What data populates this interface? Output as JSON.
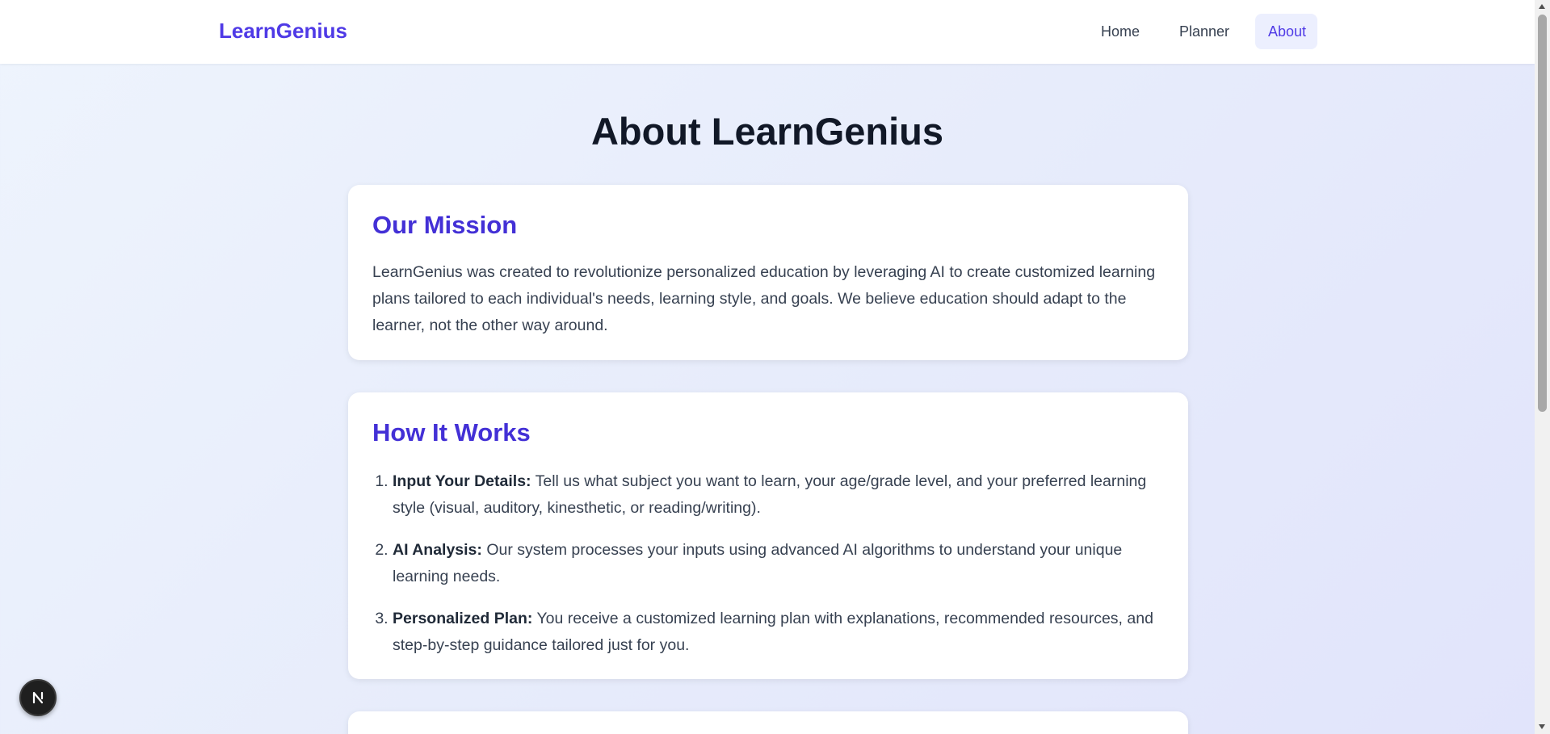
{
  "nav": {
    "brand": "LearnGenius",
    "links": [
      "Home",
      "Planner",
      "About"
    ],
    "active": "About"
  },
  "page": {
    "title": "About LearnGenius"
  },
  "mission": {
    "heading": "Our Mission",
    "text": "LearnGenius was created to revolutionize personalized education by leveraging AI to create customized learning plans tailored to each individual's needs, learning style, and goals. We believe education should adapt to the learner, not the other way around."
  },
  "how_it_works": {
    "heading": "How It Works",
    "steps": [
      {
        "title": "Input Your Details:",
        "text": " Tell us what subject you want to learn, your age/grade level, and your preferred learning style (visual, auditory, kinesthetic, or reading/writing)."
      },
      {
        "title": "AI Analysis:",
        "text": " Our system processes your inputs using advanced AI algorithms to understand your unique learning needs."
      },
      {
        "title": "Personalized Plan:",
        "text": " You receive a customized learning plan with explanations, recommended resources, and step-by-step guidance tailored just for you."
      }
    ]
  },
  "dev_badge": {
    "icon": "nextjs-icon",
    "letter": "N"
  },
  "colors": {
    "brand": "#4f3ae6",
    "heading_accent": "#4330d6",
    "active_nav_bg": "#eceffe"
  }
}
